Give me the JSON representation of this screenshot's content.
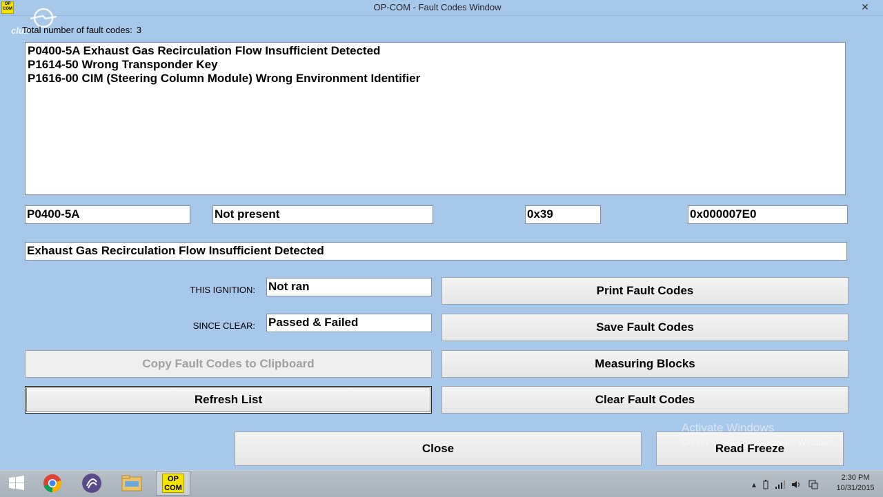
{
  "window": {
    "title": "OP-COM - Fault Codes Window",
    "app_icon_text": [
      "OP",
      "COM"
    ],
    "close_glyph": "✕"
  },
  "brand": {
    "text": "club"
  },
  "summary": {
    "label": "Total number of fault codes:",
    "count": "3"
  },
  "fault_list": [
    "P0400-5A Exhaust Gas Recirculation Flow Insufficient Detected",
    "P1614-50 Wrong Transponder Key",
    "P1616-00 CIM (Steering Column Module) Wrong Environment Identifier"
  ],
  "details": {
    "code": "P0400-5A",
    "status": "Not present",
    "hex1": "0x39",
    "hex2": "0x000007E0",
    "description": "Exhaust Gas Recirculation Flow Insufficient Detected",
    "this_ignition_label": "THIS IGNITION:",
    "this_ignition_value": "Not ran",
    "since_clear_label": "SINCE CLEAR:",
    "since_clear_value": "Passed & Failed"
  },
  "buttons": {
    "print": "Print Fault Codes",
    "save": "Save Fault Codes",
    "copy": "Copy Fault Codes to Clipboard",
    "measuring": "Measuring Blocks",
    "refresh": "Refresh List",
    "clear": "Clear Fault Codes",
    "close": "Close",
    "freeze": "Read Freeze"
  },
  "watermark": {
    "line1": "Activate Windows",
    "line2": "Go to PC settings to activate Windows."
  },
  "taskbar": {
    "opcom_text": [
      "OP",
      "COM"
    ],
    "tray_icons": [
      "chevron-up-icon",
      "battery-icon",
      "signal-icon",
      "volume-icon",
      "network-icon"
    ]
  },
  "clock": {
    "time": "2:30 PM",
    "date": "10/31/2015"
  },
  "colors": {
    "window_bg": "#a8c8ea",
    "opcom_yellow": "#f5e300"
  }
}
